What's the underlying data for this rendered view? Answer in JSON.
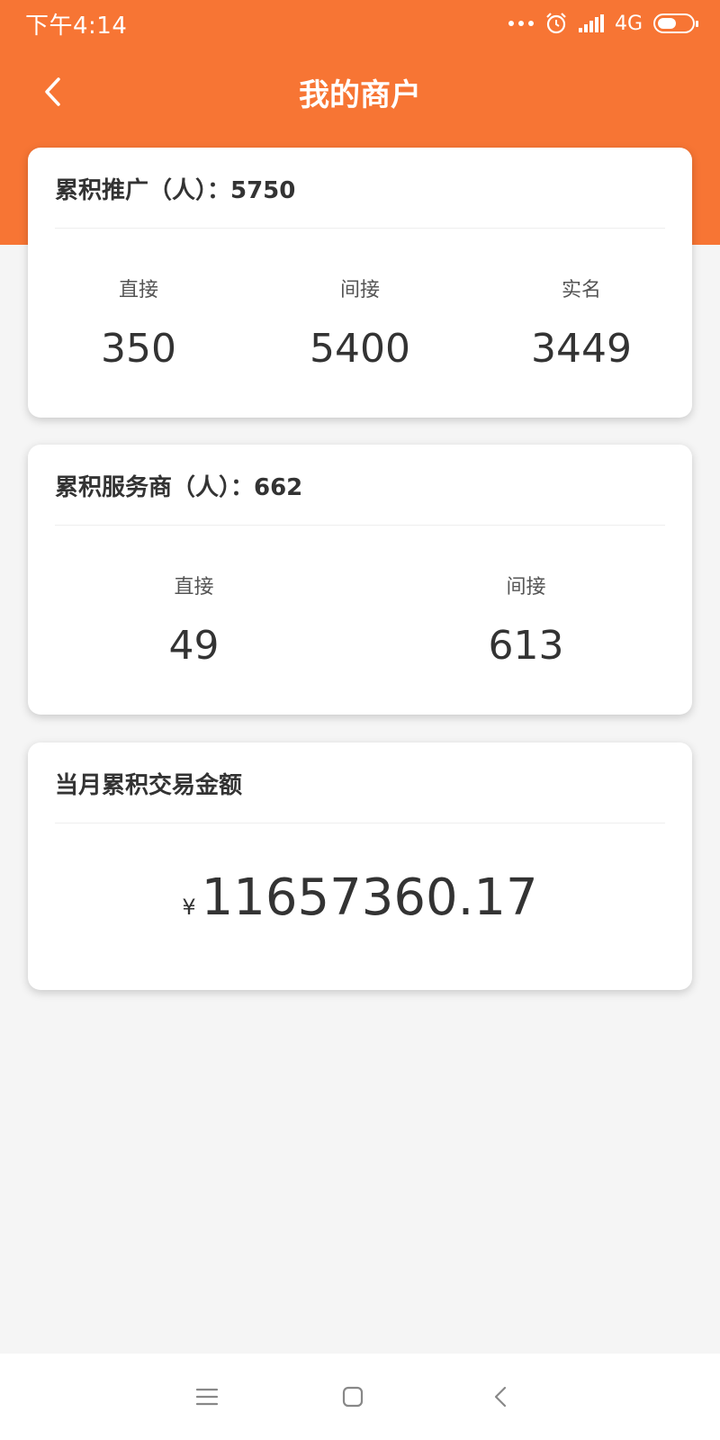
{
  "status": {
    "time": "下午4:14",
    "network": "4G"
  },
  "nav": {
    "title": "我的商户"
  },
  "promotion": {
    "title": "累积推广（人）：5750",
    "items": [
      {
        "label": "直接",
        "value": "350"
      },
      {
        "label": "间接",
        "value": "5400"
      },
      {
        "label": "实名",
        "value": "3449"
      }
    ]
  },
  "service": {
    "title": "累积服务商（人）：662",
    "items": [
      {
        "label": "直接",
        "value": "49"
      },
      {
        "label": "间接",
        "value": "613"
      }
    ]
  },
  "transaction": {
    "title": "当月累积交易金额",
    "currency": "¥",
    "amount": "11657360.17"
  },
  "colors": {
    "accent": "#f77534",
    "background": "#f5f5f5"
  },
  "icons": [
    "back-icon",
    "alarm-icon",
    "signal-icon",
    "battery-icon",
    "menu-icon",
    "home-icon",
    "nav-back-icon"
  ]
}
